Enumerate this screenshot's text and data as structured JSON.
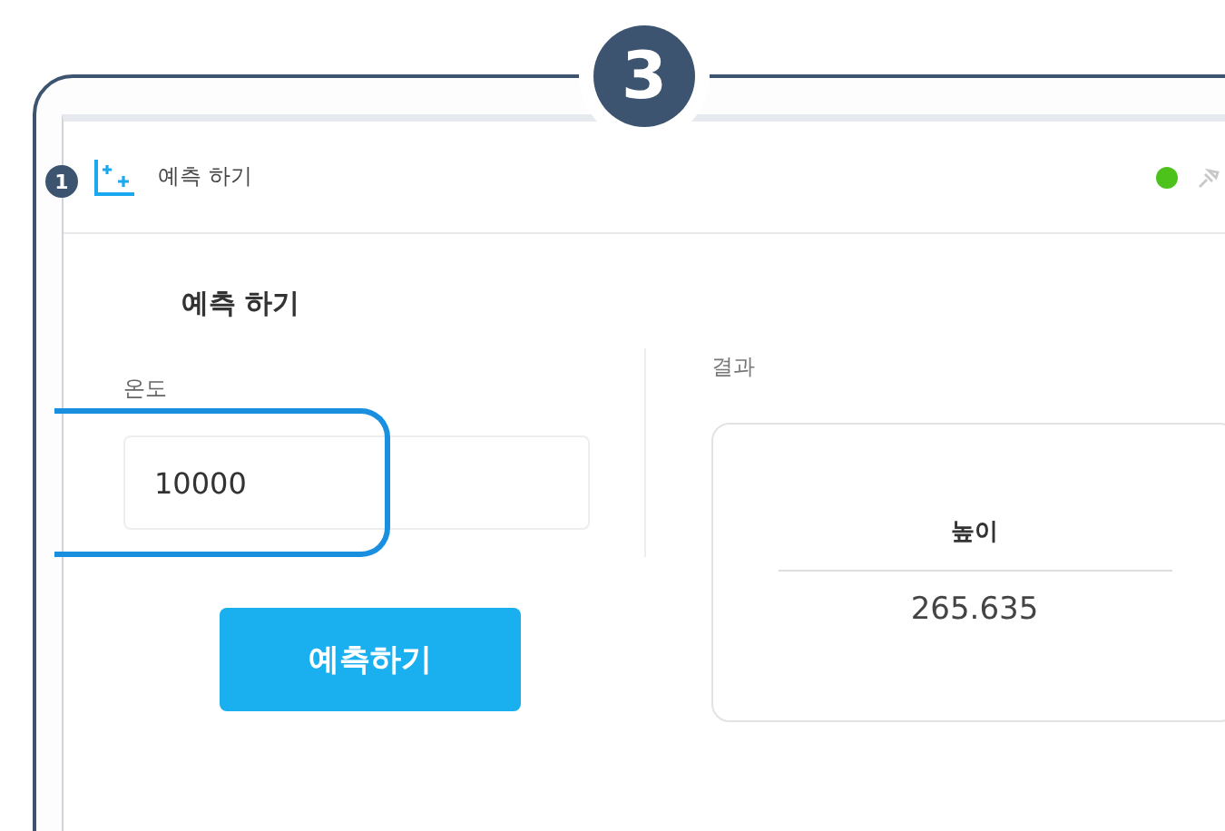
{
  "callouts": [
    {
      "number": "3"
    },
    {
      "number": "1"
    }
  ],
  "panel": {
    "title": "예측 하기",
    "status": {
      "active": true
    }
  },
  "form": {
    "heading": "예측 하기",
    "field": {
      "label": "온도",
      "value": "10000",
      "highlighted": true
    },
    "button": "예측하기"
  },
  "result": {
    "label": "결과",
    "columns": [
      {
        "header": "높이",
        "value": "265.635"
      }
    ]
  }
}
